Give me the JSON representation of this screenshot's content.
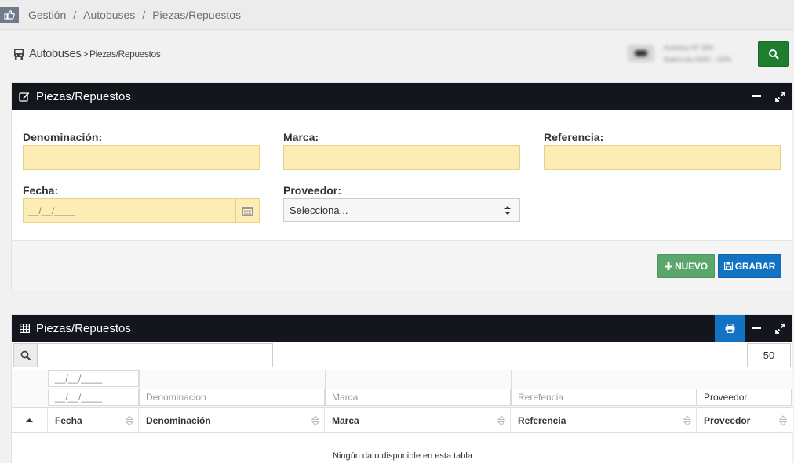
{
  "breadcrumb": {
    "items": [
      "Gestión",
      "Autobuses",
      "Piezas/Repuestos"
    ],
    "separator": "/"
  },
  "page_header": {
    "section": "Autobuses",
    "separator": ">",
    "subsection": "Piezas/Repuestos"
  },
  "vehicle": {
    "line1": "Autobus Nº 283",
    "line2": "Matrícula 0000 - GPK"
  },
  "form_panel": {
    "title": "Piezas/Repuestos",
    "fields": {
      "denominacion_label": "Denominación:",
      "marca_label": "Marca:",
      "referencia_label": "Referencia:",
      "fecha_label": "Fecha:",
      "fecha_placeholder": "__/__/____",
      "proveedor_label": "Proveedor:",
      "proveedor_value": "Selecciona..."
    },
    "buttons": {
      "nuevo": "NUEVO",
      "grabar": "GRABAR"
    }
  },
  "table_panel": {
    "title": "Piezas/Repuestos",
    "page_size": "50",
    "filters": {
      "date_from": "__/__/____",
      "date_to": "__/__/____",
      "denominacion": "Denominacion",
      "marca": "Marca",
      "referencia": "Rerefencia",
      "proveedor": "Proveedor"
    },
    "columns": [
      "Fecha",
      "Denominación",
      "Marca",
      "Referencia",
      "Proveedor"
    ],
    "empty_message": "Ningún dato disponible en esta tabla"
  },
  "colors": {
    "header_dark": "#13171d",
    "input_yellow": "#fdecb4",
    "btn_green": "#5aa66b",
    "btn_blue": "#1273c4",
    "search_green": "#1f7d2f"
  }
}
